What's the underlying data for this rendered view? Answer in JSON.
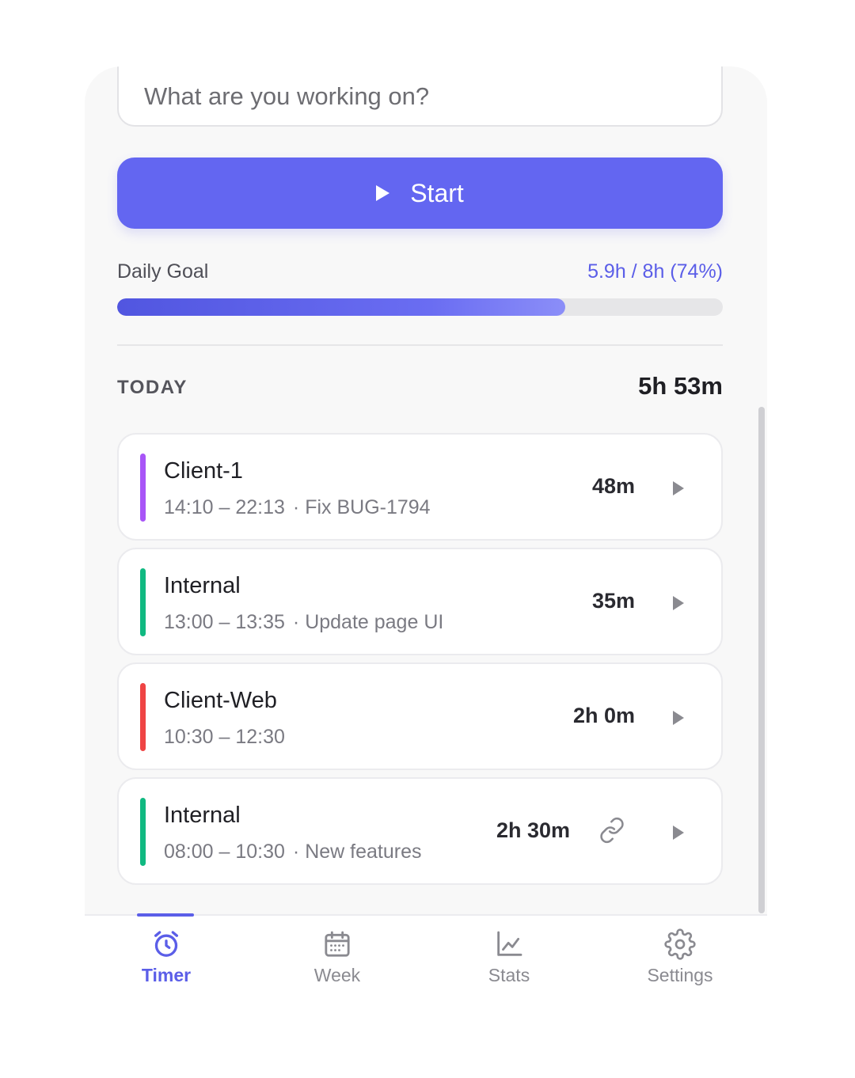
{
  "task_input": {
    "placeholder": "What are you working on?",
    "value": ""
  },
  "start_button": {
    "label": "Start"
  },
  "daily_goal": {
    "label": "Daily Goal",
    "value_text": "5.9h / 8h (74%)",
    "progress_fraction": 0.74
  },
  "today": {
    "label": "TODAY",
    "total": "5h 53m",
    "entries": [
      {
        "project": "Client-1",
        "time": "14:10 – 22:13",
        "description": "· Fix BUG-1794",
        "duration": "48m",
        "color": "#a855f7",
        "linked": false
      },
      {
        "project": "Internal",
        "time": "13:00 – 13:35",
        "description": "· Update page UI",
        "duration": "35m",
        "color": "#10b981",
        "linked": false
      },
      {
        "project": "Client-Web",
        "time": "10:30 – 12:30",
        "description": "",
        "duration": "2h 0m",
        "color": "#ef4444",
        "linked": false
      },
      {
        "project": "Internal",
        "time": "08:00 – 10:30",
        "description": "· New features",
        "duration": "2h 30m",
        "color": "#10b981",
        "linked": true
      }
    ]
  },
  "nav": {
    "items": [
      {
        "label": "Timer",
        "icon": "alarm-clock-icon",
        "active": true
      },
      {
        "label": "Week",
        "icon": "calendar-icon",
        "active": false
      },
      {
        "label": "Stats",
        "icon": "chart-line-icon",
        "active": false
      },
      {
        "label": "Settings",
        "icon": "gear-icon",
        "active": false
      }
    ]
  },
  "colors": {
    "accent": "#6366f1",
    "accent_text": "#5b5ee8"
  }
}
